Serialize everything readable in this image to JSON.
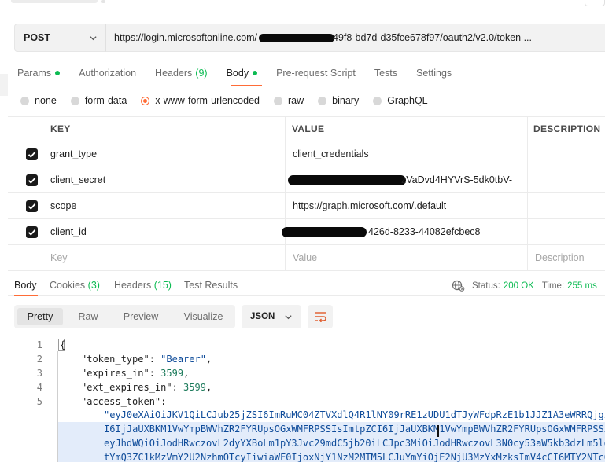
{
  "request": {
    "method": "POST",
    "url_prefix": "https://login.microsoftonline.com/",
    "url_suffix": "49f8-bd7d-d35fce678f97/oauth2/v2.0/token ..."
  },
  "request_tabs": [
    {
      "label": "Params",
      "count": "",
      "dot": true,
      "active": false
    },
    {
      "label": "Authorization",
      "count": "",
      "dot": false,
      "active": false
    },
    {
      "label": "Headers",
      "count": "(9)",
      "dot": false,
      "active": false
    },
    {
      "label": "Body",
      "count": "",
      "dot": true,
      "active": true
    },
    {
      "label": "Pre-request Script",
      "count": "",
      "dot": false,
      "active": false
    },
    {
      "label": "Tests",
      "count": "",
      "dot": false,
      "active": false
    },
    {
      "label": "Settings",
      "count": "",
      "dot": false,
      "active": false
    }
  ],
  "body_types": [
    {
      "label": "none",
      "selected": false
    },
    {
      "label": "form-data",
      "selected": false
    },
    {
      "label": "x-www-form-urlencoded",
      "selected": true
    },
    {
      "label": "raw",
      "selected": false
    },
    {
      "label": "binary",
      "selected": false
    },
    {
      "label": "GraphQL",
      "selected": false
    }
  ],
  "params_table": {
    "headers": {
      "key": "KEY",
      "value": "VALUE",
      "description": "DESCRIPTION"
    },
    "rows": [
      {
        "checked": true,
        "key": "grant_type",
        "value": "client_credentials",
        "redacted": false
      },
      {
        "checked": true,
        "key": "client_secret",
        "value": "zVaDvd4HYVrS-5dk0tbV-",
        "redacted": true
      },
      {
        "checked": true,
        "key": "scope",
        "value": "https://graph.microsoft.com/.default",
        "redacted": false
      },
      {
        "checked": true,
        "key": "client_id",
        "value": "426d-8233-44082efcbec8",
        "redacted": true
      }
    ],
    "placeholder": {
      "key": "Key",
      "value": "Value",
      "description": "Description"
    }
  },
  "response_tabs": [
    {
      "label": "Body",
      "count": "",
      "active": true
    },
    {
      "label": "Cookies",
      "count": "(3)",
      "active": false
    },
    {
      "label": "Headers",
      "count": "(15)",
      "active": false
    },
    {
      "label": "Test Results",
      "count": "",
      "active": false
    }
  ],
  "status": {
    "status_label": "Status:",
    "status_value": "200 OK",
    "time_label": "Time:",
    "time_value": "255 ms"
  },
  "view_modes": [
    "Pretty",
    "Raw",
    "Preview",
    "Visualize"
  ],
  "active_view": "Pretty",
  "format": "JSON",
  "code": {
    "line_numbers": [
      "1",
      "2",
      "3",
      "4",
      "5"
    ],
    "open_brace": "{",
    "token_type_key": "\"token_type\"",
    "token_type_value": "\"Bearer\"",
    "expires_in_key": "\"expires_in\"",
    "expires_in_value": "3599",
    "ext_expires_in_key": "\"ext_expires_in\"",
    "ext_expires_in_value": "3599",
    "access_token_key": "\"access_token\"",
    "token_lines": [
      "\"eyJ0eXAiOiJKV1QiLCJub25jZSI6ImRuMC04ZTVXdlQ4R1lNY09rRE1zUDU1dTJyWFdpRzE1b1JJZ1A3eWRRQjgi",
      "I6IjJaUXBKM1VwYmpBWVhZR2FYRUpsOGxWMFRPSSIsImtpZCI6IjJaUXBKM1VwYmpBWVhZR2FYRUpsOGxWMFRPSSJ",
      "eyJhdWQiOiJodHRwczovL2dyYXBoLm1pY3Jvc29mdC5jb20iLCJpc3MiOiJodHRwczovL3N0cy53aW5kb3dzLm5ld",
      "tYmQ3ZC1kMzVmY2U2NzhmOTcyIiwiaWF0IjoxNjY1NzM2MTM5LCJuYmYiOjE2NjU3MzYxMzksImV4cCI6MTY2NTc0"
    ]
  }
}
